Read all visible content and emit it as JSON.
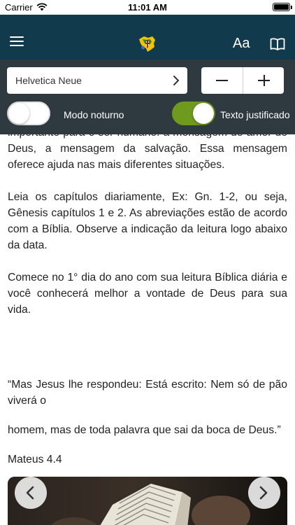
{
  "status_bar": {
    "carrier": "Carrier",
    "time": "11:01 AM"
  },
  "nav": {
    "font_size_label": "Aa",
    "icons": [
      "menu-icon",
      "logo-icon",
      "book-icon"
    ]
  },
  "settings": {
    "font_select": {
      "value": "Helvetica Neue"
    },
    "stepper": {
      "minus": "minus-icon",
      "plus": "plus-icon"
    },
    "night_mode": {
      "label": "Modo noturno",
      "on": false
    },
    "justified": {
      "label": "Texto justificado",
      "on": true,
      "color": "#6e9a1e"
    }
  },
  "content": {
    "paragraphs": [
      "importante para o ser humano: a mensagem do amor de Deus, a mensagem da salvação. Essa mensagem oferece ajuda nas mais diferentes situações.",
      "Leia os capítulos diariamente, Ex: Gn. 1-2, ou seja, Gênesis capítulos 1 e 2. As abreviações estão de acordo com a Bíblia. Observe a indicação da leitura logo abaixo da data.",
      "Comece no 1° dia do ano com sua leitura Bíblica diária e você conhecerá melhor a vontade de Deus para sua vida.",
      "“Mas Jesus lhe respondeu: Está escrito: Nem só de pão viverá o",
      "homem, mas de toda palavra que sai da boca de Deus.”",
      "Mateus 4.4"
    ]
  },
  "carousel": {
    "prev": "chevron-left-icon",
    "next": "chevron-right-icon"
  },
  "colors": {
    "nav_bg": "#123a4d",
    "panel_bg": "#2f3a40",
    "accent": "#6e9a1e"
  }
}
